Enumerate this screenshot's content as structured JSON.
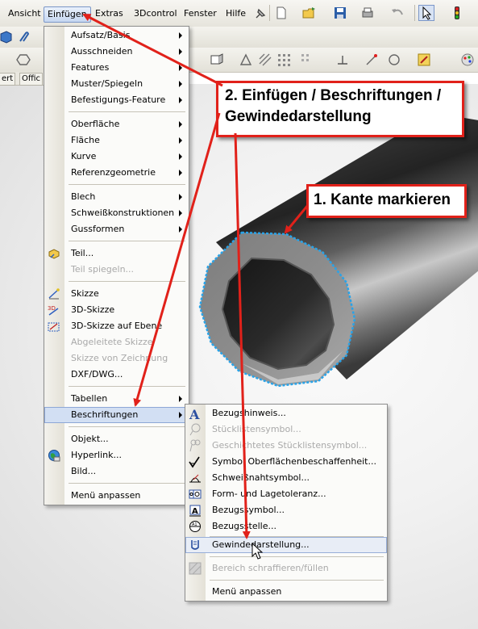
{
  "menubar": {
    "items": [
      {
        "label": "Ansicht"
      },
      {
        "label": "Einfügen"
      },
      {
        "label": "Extras"
      },
      {
        "label": "3Dcontrol"
      },
      {
        "label": "Fenster"
      },
      {
        "label": "Hilfe"
      }
    ]
  },
  "tabs": [
    {
      "label": "ert"
    },
    {
      "label": "Offic"
    }
  ],
  "insert_menu": {
    "items": [
      {
        "label": "Aufsatz/Basis",
        "submenu": true
      },
      {
        "label": "Ausschneiden",
        "submenu": true
      },
      {
        "label": "Features",
        "submenu": true
      },
      {
        "label": "Muster/Spiegeln",
        "submenu": true
      },
      {
        "label": "Befestigungs-Feature",
        "submenu": true
      },
      {
        "label": "Oberfläche",
        "submenu": true
      },
      {
        "label": "Fläche",
        "submenu": true
      },
      {
        "label": "Kurve",
        "submenu": true
      },
      {
        "label": "Referenzgeometrie",
        "submenu": true
      },
      {
        "label": "Blech",
        "submenu": true
      },
      {
        "label": "Schweißkonstruktionen",
        "submenu": true
      },
      {
        "label": "Gussformen",
        "submenu": true
      },
      {
        "label": "Teil...",
        "icon": "part-icon"
      },
      {
        "label": "Teil spiegeln...",
        "disabled": true
      },
      {
        "label": "Skizze",
        "icon": "sketch-icon"
      },
      {
        "label": "3D-Skizze",
        "icon": "3d-sketch-icon"
      },
      {
        "label": "3D-Skizze auf Ebene",
        "icon": "3d-sketch-on-plane-icon"
      },
      {
        "label": "Abgeleitete Skizze",
        "disabled": true
      },
      {
        "label": "Skizze von Zeichnung",
        "disabled": true
      },
      {
        "label": "DXF/DWG..."
      },
      {
        "label": "Tabellen",
        "submenu": true
      },
      {
        "label": "Beschriftungen",
        "submenu": true,
        "highlighted": true
      },
      {
        "label": "Objekt..."
      },
      {
        "label": "Hyperlink...",
        "icon": "hyperlink-globe-icon"
      },
      {
        "label": "Bild..."
      },
      {
        "label": "Menü anpassen"
      }
    ]
  },
  "annotations_menu": {
    "items": [
      {
        "label": "Bezugshinweis...",
        "icon": "note-icon"
      },
      {
        "label": "Stücklistensymbol...",
        "disabled": true,
        "icon": "balloon-icon"
      },
      {
        "label": "Geschichtetes Stücklistensymbol...",
        "disabled": true,
        "icon": "stacked-balloon-icon"
      },
      {
        "label": "Symbol Oberflächenbeschaffenheit...",
        "icon": "surface-finish-icon"
      },
      {
        "label": "Schweißnahtsymbol...",
        "icon": "weld-symbol-icon"
      },
      {
        "label": "Form- und Lagetoleranz...",
        "icon": "geometric-tolerance-icon"
      },
      {
        "label": "Bezugssymbol...",
        "icon": "datum-feature-icon"
      },
      {
        "label": "Bezugsstelle...",
        "icon": "datum-target-icon"
      },
      {
        "label": "Gewindedarstellung...",
        "icon": "cosmetic-thread-icon",
        "highlighted": true
      },
      {
        "label": "Bereich schraffieren/füllen",
        "disabled": true,
        "icon": "area-hatch-icon"
      },
      {
        "label": "Menü anpassen"
      }
    ]
  },
  "callouts": {
    "step2_line1": "2. Einfügen / Beschriftungen /",
    "step2_line2": "Gewindedarstellung",
    "step1": "1. Kante markieren"
  },
  "colors": {
    "annotation_red": "#e1211a",
    "menu_highlight": "#d2dff3",
    "edge_highlight": "#29a3e8"
  }
}
